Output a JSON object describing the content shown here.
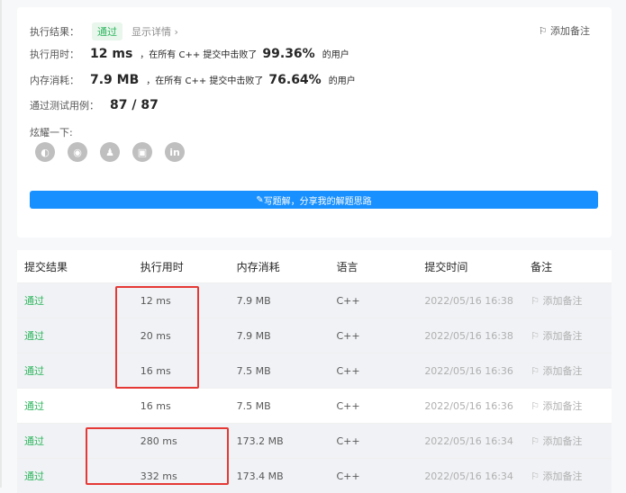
{
  "summary": {
    "result_label": "执行结果：",
    "result_value": "通过",
    "show_detail": "显示详情",
    "add_note": "添加备注",
    "runtime_label": "执行用时：",
    "runtime_value": "12 ms",
    "runtime_text": "，在所有 C++ 提交中击败了",
    "runtime_pct": "99.36%",
    "runtime_suffix": "的用户",
    "memory_label": "内存消耗：",
    "memory_value": "7.9 MB",
    "memory_text": "，在所有 C++ 提交中击败了",
    "memory_pct": "76.64%",
    "memory_suffix": "的用户",
    "tests_label": "通过测试用例：",
    "tests_value": "87 / 87",
    "share_label": "炫耀一下:",
    "share_icons": [
      "wechat-icon",
      "weibo-icon",
      "qq-icon",
      "douban-icon",
      "linkedin-icon"
    ],
    "write_button": "写题解，分享我的解题思路"
  },
  "table": {
    "headers": [
      "提交结果",
      "执行用时",
      "内存消耗",
      "语言",
      "提交时间",
      "备注"
    ],
    "rows": [
      {
        "status": "通过",
        "time": "12 ms",
        "memory": "7.9 MB",
        "lang": "C++",
        "submitted": "2022/05/16 16:38",
        "note": "添加备注"
      },
      {
        "status": "通过",
        "time": "20 ms",
        "memory": "7.9 MB",
        "lang": "C++",
        "submitted": "2022/05/16 16:38",
        "note": "添加备注"
      },
      {
        "status": "通过",
        "time": "16 ms",
        "memory": "7.5 MB",
        "lang": "C++",
        "submitted": "2022/05/16 16:36",
        "note": "添加备注"
      },
      {
        "status": "通过",
        "time": "16 ms",
        "memory": "7.5 MB",
        "lang": "C++",
        "submitted": "2022/05/16 16:36",
        "note": "添加备注"
      },
      {
        "status": "通过",
        "time": "280 ms",
        "memory": "173.2 MB",
        "lang": "C++",
        "submitted": "2022/05/16 16:34",
        "note": "添加备注"
      },
      {
        "status": "通过",
        "time": "332 ms",
        "memory": "173.4 MB",
        "lang": "C++",
        "submitted": "2022/05/16 16:34",
        "note": "添加备注"
      }
    ]
  },
  "colors": {
    "pass": "#2db55d",
    "primary": "#1890ff",
    "highlight": "#e53935"
  }
}
